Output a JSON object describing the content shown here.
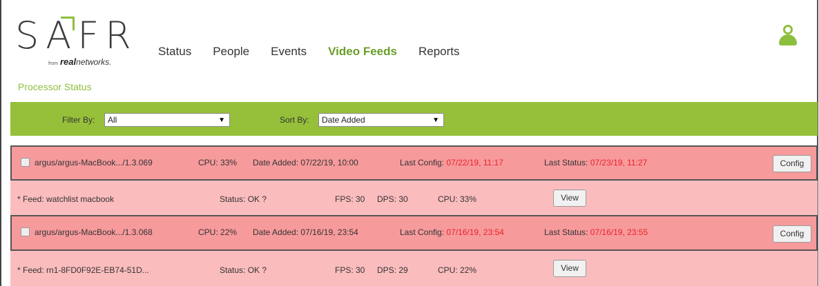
{
  "logo": {
    "wordmark": "SAFR",
    "from": "from",
    "brand_bold": "real",
    "brand_rest": "networks."
  },
  "nav": [
    {
      "label": "Status",
      "active": false
    },
    {
      "label": "People",
      "active": false
    },
    {
      "label": "Events",
      "active": false
    },
    {
      "label": "Video Feeds",
      "active": true
    },
    {
      "label": "Reports",
      "active": false
    }
  ],
  "icons": {
    "user": "user-icon",
    "dropdown": "chevron-down-icon",
    "checkbox": "checkbox"
  },
  "colors": {
    "accent": "#8dbf3f",
    "filter_bar": "#96c03a",
    "processor_row": "#f79a9c",
    "feed_row": "#fbbcbd",
    "alert_text": "#e8232a"
  },
  "section_title": "Processor Status",
  "filters": {
    "filter_label": "Filter By:",
    "filter_value": "All",
    "sort_label": "Sort By:",
    "sort_value": "Date Added"
  },
  "processors": [
    {
      "name": "argus/argus-MacBook.../1.3.069",
      "cpu_label": "CPU:",
      "cpu": "33%",
      "date_added_label": "Date Added:",
      "date_added": "07/22/19, 10:00",
      "last_config_label": "Last Config:",
      "last_config": "07/22/19, 11:17",
      "last_status_label": "Last Status:",
      "last_status": "07/23/19, 11:27",
      "config_button": "Config",
      "feed": {
        "feed": "* Feed: watchlist macbook",
        "status": "Status: OK ?",
        "fps": "FPS: 30",
        "dps": "DPS: 30",
        "cpu": "CPU: 33%",
        "view_button": "View"
      }
    },
    {
      "name": "argus/argus-MacBook.../1.3.068",
      "cpu_label": "CPU:",
      "cpu": "22%",
      "date_added_label": "Date Added:",
      "date_added": "07/16/19, 23:54",
      "last_config_label": "Last Config:",
      "last_config": "07/16/19, 23:54",
      "last_status_label": "Last Status:",
      "last_status": "07/16/19, 23:55",
      "config_button": "Config",
      "feed": {
        "feed": "* Feed: rn1-8FD0F92E-EB74-51D...",
        "status": "Status: OK ?",
        "fps": "FPS: 30",
        "dps": "DPS: 29",
        "cpu": "CPU: 22%",
        "view_button": "View"
      }
    }
  ]
}
